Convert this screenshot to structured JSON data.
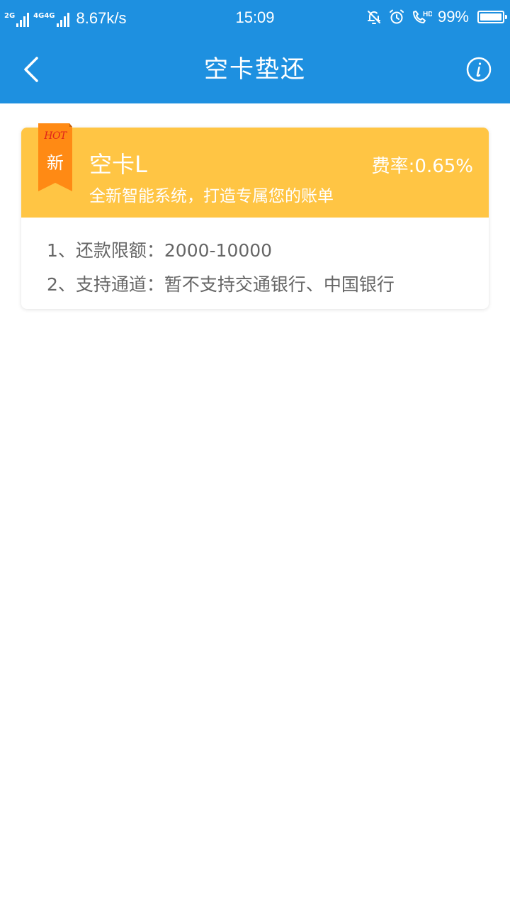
{
  "status_bar": {
    "sim1_network": "2G",
    "sim2_network": "4G4G",
    "speed": "8.67k/s",
    "time": "15:09",
    "battery_percent": "99%",
    "battery_level": 0.99,
    "icons": [
      "bell-off-icon",
      "alarm-icon",
      "hd-call-icon"
    ]
  },
  "header": {
    "title": "空卡垫还",
    "back_icon": "chevron-left-icon",
    "info_icon": "info-circle-icon",
    "background": "#1e90e0"
  },
  "card": {
    "ribbon": {
      "hot": "HOT",
      "new": "新",
      "color": "#ff8a14"
    },
    "name": "空卡L",
    "rate": "费率:0.65%",
    "description": "全新智能系统，打造专属您的账单",
    "header_color": "#ffc544",
    "details": [
      "1、还款限额：2000-10000",
      "2、支持通道：暂不支持交通银行、中国银行"
    ]
  }
}
